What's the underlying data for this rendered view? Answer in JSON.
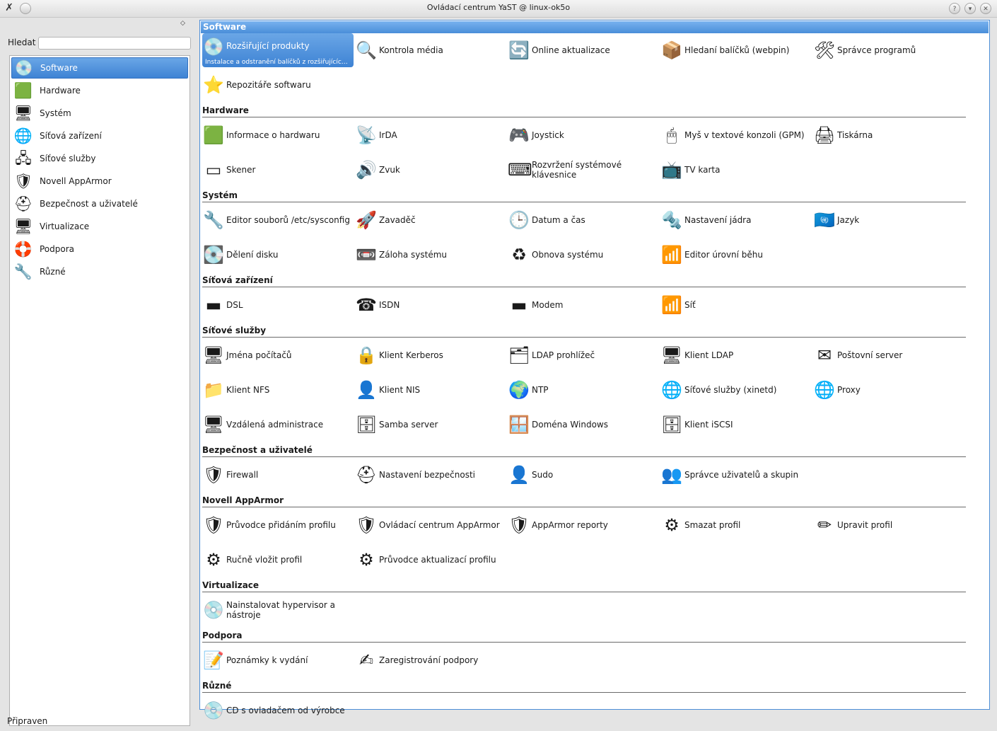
{
  "window": {
    "title": "Ovládací centrum YaST @ linux-ok5o"
  },
  "search": {
    "label": "Hledat",
    "value": ""
  },
  "status": "Připraven",
  "sidebar": {
    "items": [
      {
        "label": "Software",
        "icon": "💿",
        "selected": true
      },
      {
        "label": "Hardware",
        "icon": "🟩"
      },
      {
        "label": "Systém",
        "icon": "🖥"
      },
      {
        "label": "Síťová zařízení",
        "icon": "🌐"
      },
      {
        "label": "Síťové služby",
        "icon": "🖧"
      },
      {
        "label": "Novell AppArmor",
        "icon": "🛡"
      },
      {
        "label": "Bezpečnost a uživatelé",
        "icon": "⛑"
      },
      {
        "label": "Virtualizace",
        "icon": "🖥"
      },
      {
        "label": "Podpora",
        "icon": "🛟"
      },
      {
        "label": "Různé",
        "icon": "🔧"
      }
    ]
  },
  "sections": [
    {
      "title": "Software",
      "items": [
        {
          "label": "Rozšiřující produkty",
          "sub": "Instalace a odstranění balíčků z rozšiřujících prod...",
          "icon": "💿",
          "selected": true
        },
        {
          "label": "Kontrola média",
          "icon": "🔍"
        },
        {
          "label": "Online aktualizace",
          "icon": "🔄"
        },
        {
          "label": "Hledaní balíčků (webpin)",
          "icon": "📦"
        },
        {
          "label": "Správce programů",
          "icon": "🛠"
        },
        {
          "label": "Repozitáře softwaru",
          "icon": "⭐"
        }
      ]
    },
    {
      "title": "Hardware",
      "items": [
        {
          "label": "Informace o hardwaru",
          "icon": "🟩"
        },
        {
          "label": "IrDA",
          "icon": "📡"
        },
        {
          "label": "Joystick",
          "icon": "🎮"
        },
        {
          "label": "Myš v textové konzoli (GPM)",
          "icon": "🖱"
        },
        {
          "label": "Tiskárna",
          "icon": "🖨"
        },
        {
          "label": "Skener",
          "icon": "▭"
        },
        {
          "label": "Zvuk",
          "icon": "🔊"
        },
        {
          "label": "Rozvržení systémové klávesnice",
          "icon": "⌨"
        },
        {
          "label": "TV karta",
          "icon": "📺"
        }
      ]
    },
    {
      "title": "Systém",
      "items": [
        {
          "label": "Editor souborů /etc/sysconfig",
          "icon": "🔧"
        },
        {
          "label": "Zavaděč",
          "icon": "🚀"
        },
        {
          "label": "Datum a čas",
          "icon": "🕒"
        },
        {
          "label": "Nastavení jádra",
          "icon": "🔩"
        },
        {
          "label": "Jazyk",
          "icon": "🇺🇳"
        },
        {
          "label": "Dělení disku",
          "icon": "💽"
        },
        {
          "label": "Záloha systému",
          "icon": "📼"
        },
        {
          "label": "Obnova systému",
          "icon": "♻"
        },
        {
          "label": "Editor úrovní běhu",
          "icon": "📶"
        }
      ]
    },
    {
      "title": "Síťová zařízení",
      "items": [
        {
          "label": "DSL",
          "icon": "▬"
        },
        {
          "label": "ISDN",
          "icon": "☎"
        },
        {
          "label": "Modem",
          "icon": "▬"
        },
        {
          "label": "Síť",
          "icon": "📶"
        }
      ]
    },
    {
      "title": "Síťové služby",
      "items": [
        {
          "label": "Jména počítačů",
          "icon": "🖥"
        },
        {
          "label": "Klient Kerberos",
          "icon": "🔒"
        },
        {
          "label": "LDAP prohlížeč",
          "icon": "🗂"
        },
        {
          "label": "Klient LDAP",
          "icon": "🖥"
        },
        {
          "label": "Poštovní server",
          "icon": "✉"
        },
        {
          "label": "Klient NFS",
          "icon": "📁"
        },
        {
          "label": "Klient NIS",
          "icon": "👤"
        },
        {
          "label": "NTP",
          "icon": "🌍"
        },
        {
          "label": "Síťové služby (xinetd)",
          "icon": "🌐"
        },
        {
          "label": "Proxy",
          "icon": "🌐"
        },
        {
          "label": "Vzdálená administrace",
          "icon": "🖥"
        },
        {
          "label": "Samba server",
          "icon": "🗄"
        },
        {
          "label": "Doména Windows",
          "icon": "🪟"
        },
        {
          "label": "Klient iSCSI",
          "icon": "🗄"
        }
      ]
    },
    {
      "title": "Bezpečnost a uživatelé",
      "items": [
        {
          "label": "Firewall",
          "icon": "🛡"
        },
        {
          "label": "Nastavení bezpečnosti",
          "icon": "⛑"
        },
        {
          "label": "Sudo",
          "icon": "👤"
        },
        {
          "label": "Správce uživatelů a skupin",
          "icon": "👥"
        }
      ]
    },
    {
      "title": "Novell AppArmor",
      "items": [
        {
          "label": "Průvodce přidáním profilu",
          "icon": "🛡"
        },
        {
          "label": "Ovládací centrum AppArmor",
          "icon": "🛡"
        },
        {
          "label": "AppArmor reporty",
          "icon": "🛡"
        },
        {
          "label": "Smazat profil",
          "icon": "⚙"
        },
        {
          "label": "Upravit profil",
          "icon": "✏"
        },
        {
          "label": "Ručně vložit profil",
          "icon": "⚙"
        },
        {
          "label": "Průvodce aktualizací profilu",
          "icon": "⚙"
        }
      ]
    },
    {
      "title": "Virtualizace",
      "items": [
        {
          "label": "Nainstalovat hypervisor a nástroje",
          "icon": "💿"
        }
      ]
    },
    {
      "title": "Podpora",
      "items": [
        {
          "label": "Poznámky k vydání",
          "icon": "📝"
        },
        {
          "label": "Zaregistrování podpory",
          "icon": "✍"
        }
      ]
    },
    {
      "title": "Různé",
      "items": [
        {
          "label": "CD s ovladačem od výrobce",
          "icon": "💿"
        }
      ]
    }
  ]
}
